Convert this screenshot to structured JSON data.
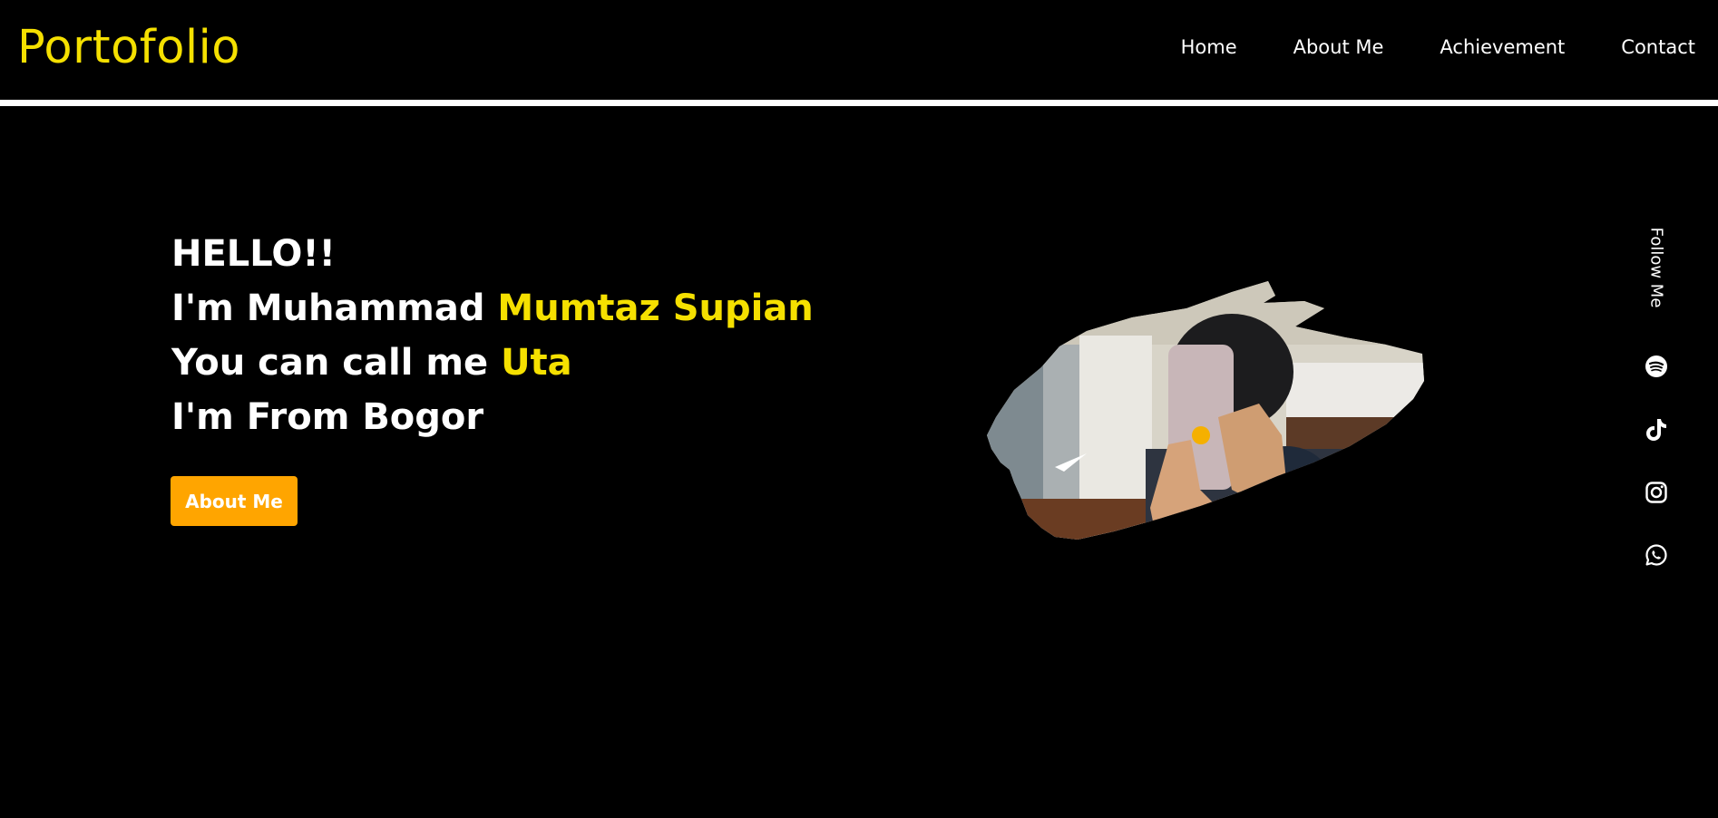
{
  "colors": {
    "accent": "#f5e000",
    "button": "#ffa500",
    "background": "#000000",
    "text": "#ffffff"
  },
  "header": {
    "brand": "Portofolio",
    "nav": [
      {
        "label": "Home"
      },
      {
        "label": "About Me"
      },
      {
        "label": "Achievement"
      },
      {
        "label": "Contact"
      }
    ]
  },
  "hero": {
    "greeting": "HELLO!!",
    "line2_prefix": "I'm Muhammad ",
    "line2_accent": "Mumtaz Supian",
    "line3_prefix": "You can call me ",
    "line3_accent": "Uta",
    "line4": "I'm From Bogor",
    "cta_label": "About Me"
  },
  "sidebar": {
    "follow_label": "Follow Me",
    "icons": [
      "spotify-icon",
      "tiktok-icon",
      "instagram-icon",
      "whatsapp-icon"
    ]
  }
}
